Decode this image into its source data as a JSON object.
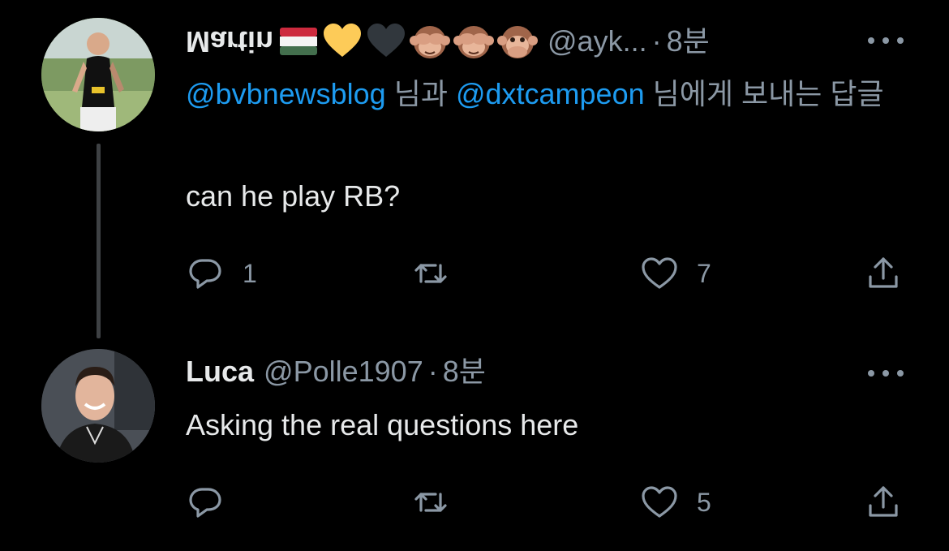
{
  "tweets": [
    {
      "display_name_flipped": "Martin",
      "emojis": [
        "hungary-flag-icon",
        "yellow-heart-icon",
        "black-heart-icon",
        "see-no-evil-monkey-icon",
        "see-no-evil-monkey-icon",
        "speak-no-evil-monkey-icon"
      ],
      "handle": "@ayk...",
      "separator": "·",
      "time": "8분",
      "replying": {
        "mention1": "@bvbnewsblog",
        "connector": " 님과 ",
        "mention2": "@dxtcampeon",
        "suffix": " 님에게 보내는 답글"
      },
      "text": "can he play RB?",
      "actions": {
        "reply_count": "1",
        "retweet_count": "",
        "like_count": "7"
      }
    },
    {
      "display_name": "Luca",
      "handle": "@Polle1907",
      "separator": "·",
      "time": "8분",
      "text": "Asking the real questions here",
      "actions": {
        "reply_count": "",
        "retweet_count": "",
        "like_count": "5"
      }
    }
  ],
  "colors": {
    "background": "#000000",
    "text": "#e7e9ea",
    "muted": "#8b98a5",
    "link": "#1d9bf0"
  }
}
